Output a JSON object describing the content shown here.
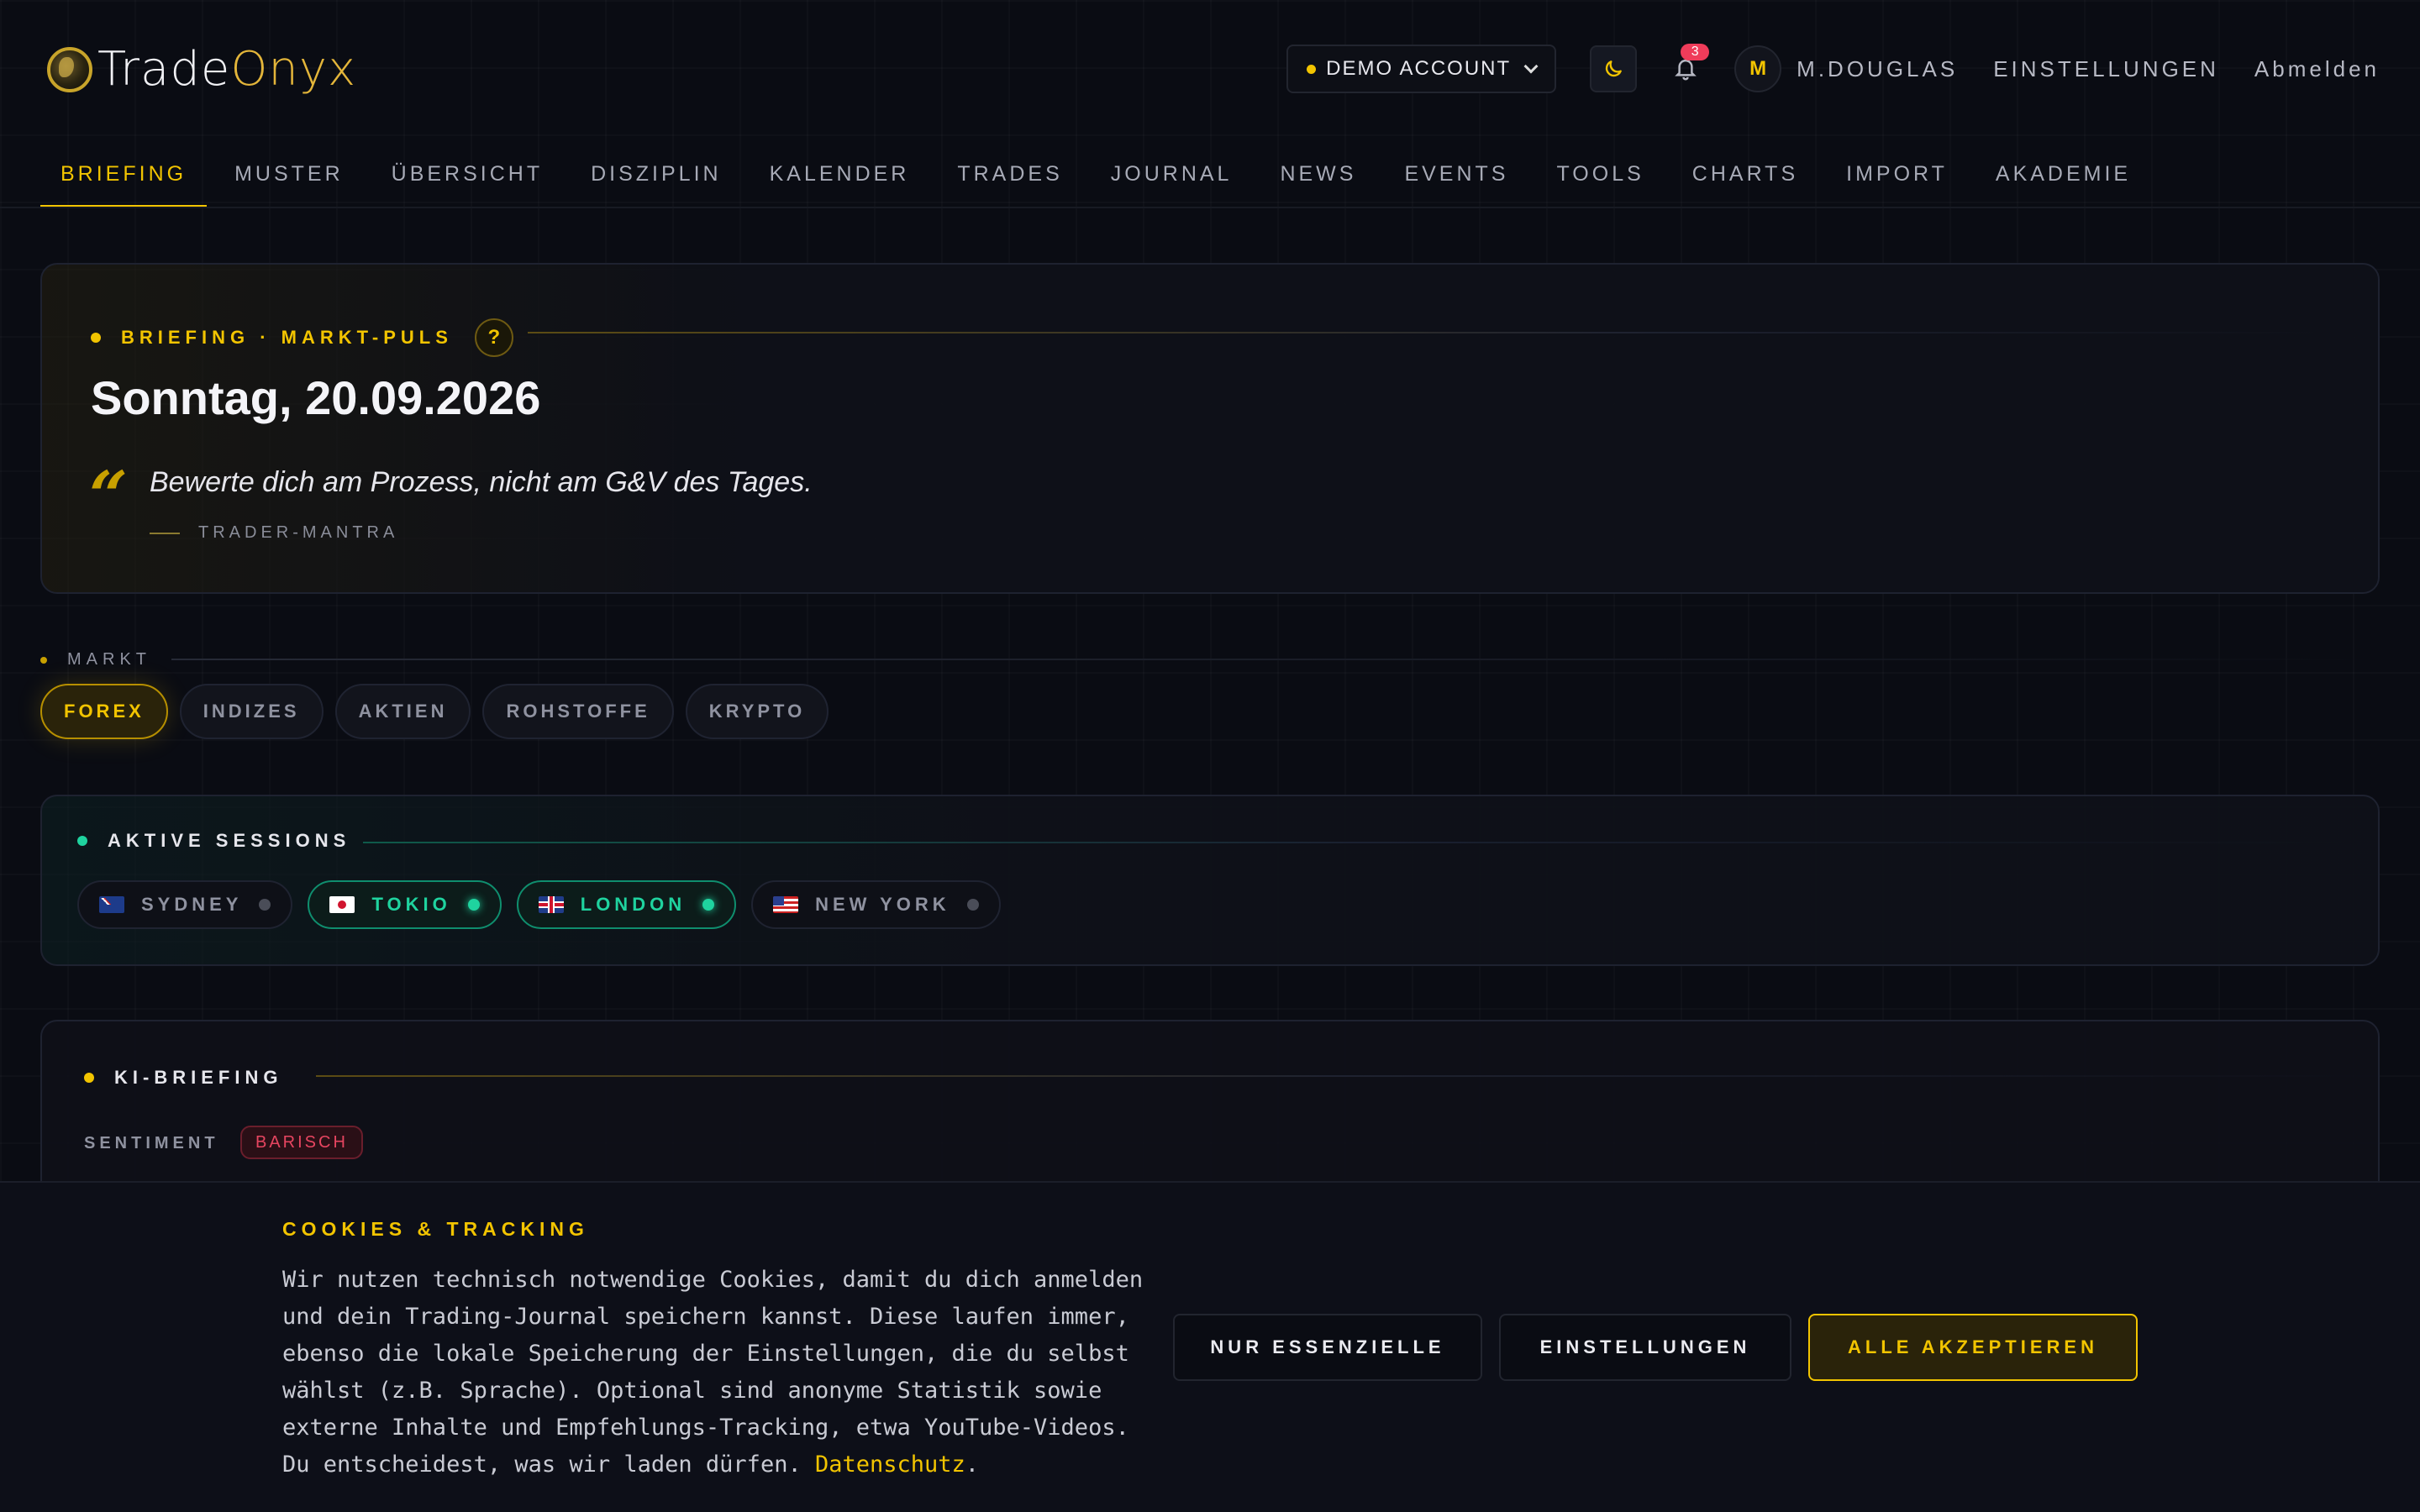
{
  "brand": {
    "part1": "Trade",
    "part2": "Onyx"
  },
  "header": {
    "account": "DEMO ACCOUNT",
    "notifications": "3",
    "avatar_initial": "M",
    "username": "M.DOUGLAS",
    "settings": "EINSTELLUNGEN",
    "logout": "Abmelden"
  },
  "nav": [
    "BRIEFING",
    "MUSTER",
    "ÜBERSICHT",
    "DISZIPLIN",
    "KALENDER",
    "TRADES",
    "JOURNAL",
    "NEWS",
    "EVENTS",
    "TOOLS",
    "CHARTS",
    "IMPORT",
    "AKADEMIE"
  ],
  "briefing": {
    "eyebrow": "BRIEFING · MARKT-PULS",
    "help": "?",
    "date": "Sonntag, 20.09.2026",
    "quote_mark": "“",
    "quote": "Bewerte dich am Prozess, nicht am G&V des Tages.",
    "quote_by": "TRADER-MANTRA"
  },
  "markt": {
    "label": "MARKT",
    "chips": [
      "FOREX",
      "INDIZES",
      "AKTIEN",
      "ROHSTOFFE",
      "KRYPTO"
    ],
    "active": "FOREX"
  },
  "sessions": {
    "label": "AKTIVE SESSIONS",
    "items": [
      {
        "name": "SYDNEY",
        "active": false
      },
      {
        "name": "TOKIO",
        "active": true
      },
      {
        "name": "LONDON",
        "active": true
      },
      {
        "name": "NEW YORK",
        "active": false
      }
    ]
  },
  "ki": {
    "label": "KI-BRIEFING",
    "sentiment_label": "SENTIMENT",
    "sentiment": "BARISCH"
  },
  "cookie": {
    "title": "COOKIES & TRACKING",
    "text": "Wir nutzen technisch notwendige Cookies, damit du dich anmelden und dein Trading-Journal speichern kannst. Diese laufen immer, ebenso die lokale Speicherung der Einstellungen, die du selbst wählst (z.B. Sprache). Optional sind anonyme Statistik sowie externe Inhalte und Empfehlungs-Tracking, etwa YouTube-Videos. Du entscheidest, was wir laden dürfen.",
    "link": "Datenschutz",
    "link_suffix": ".",
    "btn_essential": "NUR ESSENZIELLE",
    "btn_settings": "EINSTELLUNGEN",
    "btn_accept": "ALLE AKZEPTIEREN"
  },
  "colors": {
    "accent": "#f2c400",
    "session_active": "#1fd39f",
    "bearish": "#e64560"
  }
}
